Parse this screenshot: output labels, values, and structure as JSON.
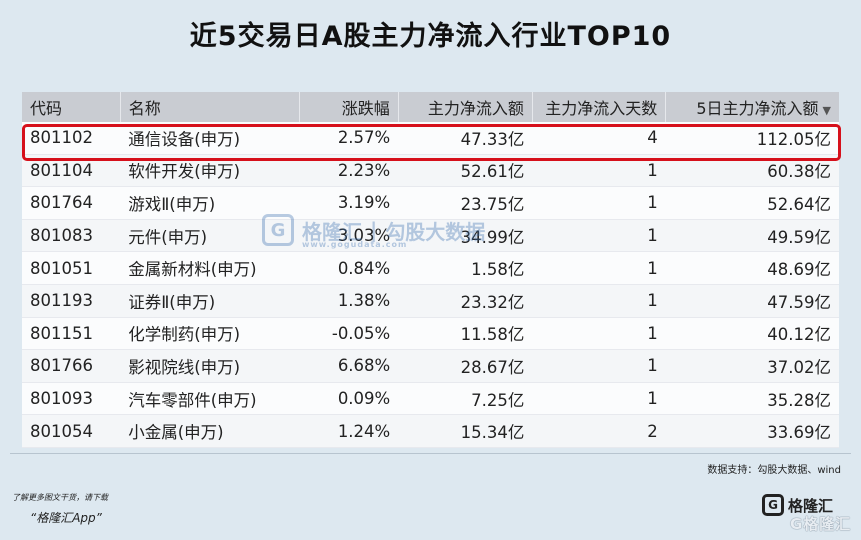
{
  "title": "近5交易日A股主力净流入行业TOP10",
  "table": {
    "headers": [
      "代码",
      "名称",
      "涨跌幅",
      "主力净流入额",
      "主力净流入天数",
      "5日主力净流入额"
    ],
    "sort_icon": "sort-desc-icon",
    "rows": [
      {
        "code": "801102",
        "name": "通信设备(申万)",
        "change": "2.57%",
        "flow": "47.33亿",
        "days": "4",
        "five_day": "112.05亿",
        "dir": "up"
      },
      {
        "code": "801104",
        "name": "软件开发(申万)",
        "change": "2.23%",
        "flow": "52.61亿",
        "days": "1",
        "five_day": "60.38亿",
        "dir": "up"
      },
      {
        "code": "801764",
        "name": "游戏Ⅱ(申万)",
        "change": "3.19%",
        "flow": "23.75亿",
        "days": "1",
        "five_day": "52.64亿",
        "dir": "up"
      },
      {
        "code": "801083",
        "name": "元件(申万)",
        "change": "3.03%",
        "flow": "34.99亿",
        "days": "1",
        "five_day": "49.59亿",
        "dir": "up"
      },
      {
        "code": "801051",
        "name": "金属新材料(申万)",
        "change": "0.84%",
        "flow": "1.58亿",
        "days": "1",
        "five_day": "48.69亿",
        "dir": "up"
      },
      {
        "code": "801193",
        "name": "证券Ⅱ(申万)",
        "change": "1.38%",
        "flow": "23.32亿",
        "days": "1",
        "five_day": "47.59亿",
        "dir": "up"
      },
      {
        "code": "801151",
        "name": "化学制药(申万)",
        "change": "-0.05%",
        "flow": "11.58亿",
        "days": "1",
        "five_day": "40.12亿",
        "dir": "down"
      },
      {
        "code": "801766",
        "name": "影视院线(申万)",
        "change": "6.68%",
        "flow": "28.67亿",
        "days": "1",
        "five_day": "37.02亿",
        "dir": "up"
      },
      {
        "code": "801093",
        "name": "汽车零部件(申万)",
        "change": "0.09%",
        "flow": "7.25亿",
        "days": "1",
        "five_day": "35.28亿",
        "dir": "up"
      },
      {
        "code": "801054",
        "name": "小金属(申万)",
        "change": "1.24%",
        "flow": "15.34亿",
        "days": "2",
        "five_day": "33.69亿",
        "dir": "up"
      }
    ]
  },
  "watermark": {
    "brand": "格隆汇",
    "separator": "|",
    "partner": "勾股大数据",
    "url": "www.gogudata.com",
    "logo_letter": "G"
  },
  "footer": {
    "source": "数据支持：勾股大数据、wind",
    "promo_line1": "了解更多图文干货，请下载",
    "promo_line2": "“格隆汇App”",
    "brand": "格隆汇",
    "brand_watermark": "G格隆汇",
    "logo_letter": "G"
  },
  "colors": {
    "up": "#c0102a",
    "down": "#1a8a2a",
    "highlight": "#d6101b",
    "header_bg": "#c9ccd2",
    "page_bg": "#dde8f0"
  }
}
